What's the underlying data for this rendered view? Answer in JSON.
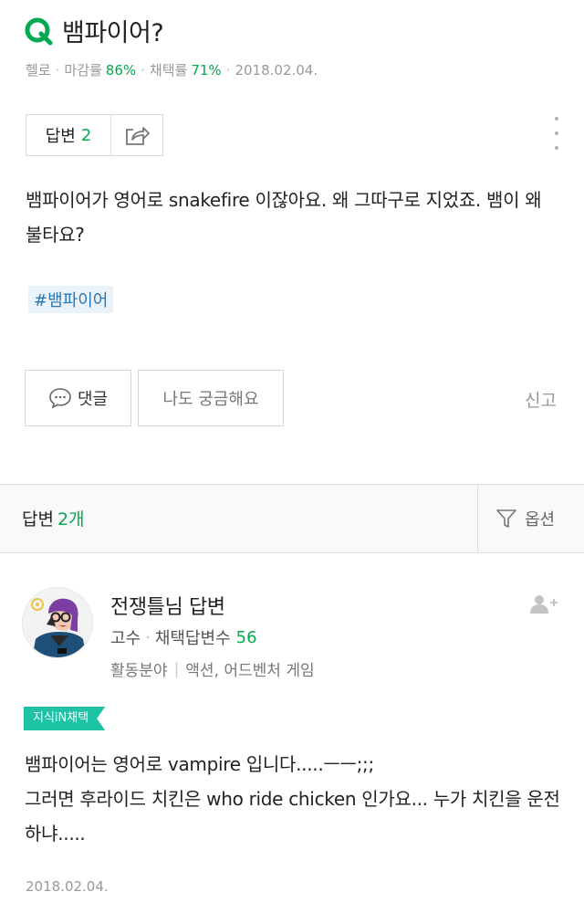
{
  "question": {
    "title": "뱀파이어?",
    "meta": {
      "level": "헬로",
      "close_rate_label": "마감률",
      "close_rate": "86%",
      "select_rate_label": "채택률",
      "select_rate": "71%",
      "date": "2018.02.04."
    },
    "answer_label": "답변",
    "answer_count": "2",
    "body": "뱀파이어가 영어로 snakefire 이잖아요. 왜 그따구로 지었죠. 뱀이 왜 불타요?",
    "hashtag": "#뱀파이어",
    "comment_label": "댓글",
    "curious_label": "나도 궁금해요",
    "report_label": "신고"
  },
  "answers_header": {
    "label": "답변",
    "count": "2개",
    "options_label": "옵션"
  },
  "answer": {
    "name": "전쟁틀님 답변",
    "rank": "고수",
    "selected_count_label": "채택답변수",
    "selected_count": "56",
    "field_label": "활동분야",
    "field_value": "액션, 어드벤처 게임",
    "badge": "지식iN채택",
    "body": "뱀파이어는 영어로 vampire 입니다.....ㅡㅡ;;;\n그러면 후라이드 치킨은 who ride chicken 인가요... 누가 치킨을 운전하냐.....",
    "date": "2018.02.04."
  },
  "colors": {
    "accent_green": "#03a94e",
    "badge_teal": "#1ec2a4",
    "hashtag_blue": "#2a77b5"
  }
}
